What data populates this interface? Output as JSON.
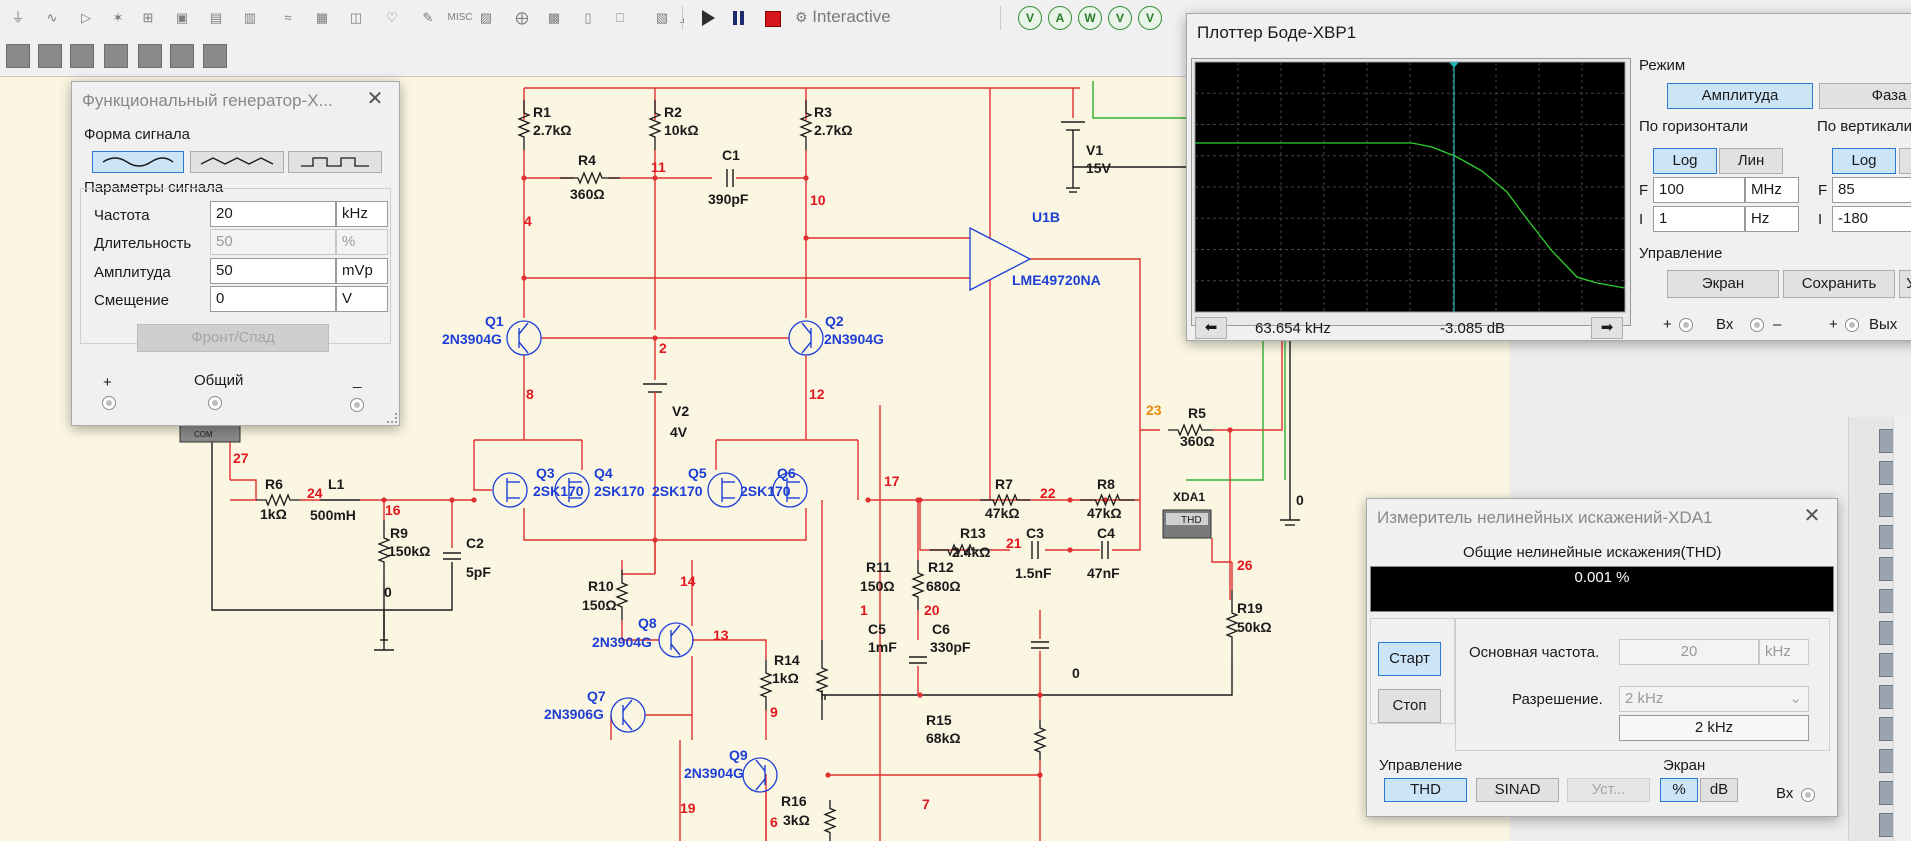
{
  "toolbar": {
    "icon_names": [
      "ground-icon",
      "ac-source-icon",
      "diode-icon",
      "transistor-icon",
      "opamp-icon",
      "ttl-icon",
      "cmos-icon",
      "mcu-icon",
      "adv-icon",
      "misc-digital-icon",
      "mixed-icon",
      "indicator-icon",
      "power-icon",
      "misc-icon",
      "peripherals-icon",
      "rf-icon",
      "electromech-icon",
      "ni-icon",
      "connector-icon",
      "hier-block-icon",
      "bus-icon"
    ],
    "misc_label": "MISC",
    "mode_label": "Interactive",
    "probe_icons": [
      "voltage-probe-icon",
      "current-probe-icon",
      "power-probe-icon",
      "diff-probe-icon",
      "ref-probe-icon"
    ],
    "probe_letters": [
      "V",
      "A",
      "W",
      "V",
      "V"
    ]
  },
  "func_gen": {
    "title": "Функциональный генератор-X...",
    "waveform_label": "Форма сигнала",
    "params_label": "Параметры сигнала",
    "freq_label": "Частота",
    "freq_value": "20",
    "freq_unit": "kHz",
    "duty_label": "Длительность",
    "duty_value": "50",
    "duty_unit": "%",
    "amp_label": "Амплитуда",
    "amp_value": "50",
    "amp_unit": "mVp",
    "offset_label": "Смещение",
    "offset_value": "0",
    "offset_unit": "V",
    "rise_button": "Фронт/Спад",
    "plus_label": "+",
    "common_label": "Общий",
    "minus_label": "_"
  },
  "bode": {
    "title": "Плоттер Боде-XBP1",
    "mode_label": "Режим",
    "amp_button": "Амплитуда",
    "phase_button": "Фаза",
    "horiz_label": "По горизонтали",
    "vert_label": "По вертикали",
    "log_label": "Log",
    "lin_label": "Лин",
    "log2_label": "Log",
    "hf_prefix": "F",
    "hf_value": "100",
    "hf_unit": "MHz",
    "hi_prefix": "I",
    "hi_value": "1",
    "hi_unit": "Hz",
    "vf_prefix": "F",
    "vf_value": "85",
    "vi_prefix": "I",
    "vi_value": "-180",
    "control_label": "Управление",
    "screen_button": "Экран",
    "save_button": "Сохранить",
    "set_button": "Уст.",
    "freq_readout": "63.654 kHz",
    "db_readout": "-3.085 dB",
    "in_label": "Вх",
    "out_label": "Вых",
    "plus": "+",
    "minus": "–",
    "curve_color": "#2fd02f",
    "cursor_color": "#23b0b0"
  },
  "thd": {
    "title": "Измеритель нелинейных искажений-XDA1",
    "thd_label": "Общие нелинейные искажения(THD)",
    "thd_value": "0.001 %",
    "start_button": "Старт",
    "stop_button": "Стоп",
    "fund_label": "Основная частота.",
    "fund_value": "20",
    "fund_unit": "kHz",
    "res_label": "Разрешение.",
    "res_select": "2 kHz",
    "res_value": "2 kHz",
    "control_label": "Управление",
    "thd_button": "THD",
    "sinad_button": "SINAD",
    "set_button": "Уст...",
    "screen_label": "Экран",
    "percent_button": "%",
    "db_button": "dB",
    "in_label": "Вх"
  },
  "schematic": {
    "wire_color": "#e03030",
    "wire_dark": "#1a1a1a",
    "wire_green": "#2fb02f",
    "label_color": "#1a1a1a",
    "part_color": "#1d3fd6",
    "net_color": "#e0171c",
    "net_orange": "#ea8a0a",
    "labels": [
      {
        "id": "r1",
        "t": "R1"
      },
      {
        "id": "r1v",
        "t": "2.7kΩ"
      },
      {
        "id": "r2",
        "t": "R2"
      },
      {
        "id": "r2v",
        "t": "10kΩ"
      },
      {
        "id": "r3",
        "t": "R3"
      },
      {
        "id": "r3v",
        "t": "2.7kΩ"
      },
      {
        "id": "r4",
        "t": "R4"
      },
      {
        "id": "r4v",
        "t": "360Ω"
      },
      {
        "id": "c1",
        "t": "C1"
      },
      {
        "id": "c1v",
        "t": "390pF"
      },
      {
        "id": "v1",
        "t": "V1"
      },
      {
        "id": "v1v",
        "t": "15V"
      },
      {
        "id": "u1b",
        "t": "U1B"
      },
      {
        "id": "lme",
        "t": "LME49720NA"
      },
      {
        "id": "q1",
        "t": "Q1"
      },
      {
        "id": "q1v",
        "t": "2N3904G"
      },
      {
        "id": "q2",
        "t": "Q2"
      },
      {
        "id": "q2v",
        "t": "2N3904G"
      },
      {
        "id": "v2",
        "t": "V2"
      },
      {
        "id": "v2v",
        "t": "4V"
      },
      {
        "id": "q3",
        "t": "Q3"
      },
      {
        "id": "q4",
        "t": "Q4"
      },
      {
        "id": "q5",
        "t": "Q5"
      },
      {
        "id": "q6",
        "t": "Q6"
      },
      {
        "id": "q3v",
        "t": "2SK170"
      },
      {
        "id": "q4v",
        "t": "2SK170"
      },
      {
        "id": "q5v",
        "t": "2SK170"
      },
      {
        "id": "q6v",
        "t": "2SK170"
      },
      {
        "id": "r5",
        "t": "R5"
      },
      {
        "id": "r5v",
        "t": "360Ω"
      },
      {
        "id": "r6",
        "t": "R6"
      },
      {
        "id": "r6v",
        "t": "1kΩ"
      },
      {
        "id": "l1",
        "t": "L1"
      },
      {
        "id": "l1v",
        "t": "500mH"
      },
      {
        "id": "r9",
        "t": "R9"
      },
      {
        "id": "r9v",
        "t": "150kΩ"
      },
      {
        "id": "c2",
        "t": "C2"
      },
      {
        "id": "c2v",
        "t": "5pF"
      },
      {
        "id": "r7",
        "t": "R7"
      },
      {
        "id": "r7v",
        "t": "47kΩ"
      },
      {
        "id": "r8",
        "t": "R8"
      },
      {
        "id": "r8v",
        "t": "47kΩ"
      },
      {
        "id": "r13",
        "t": "R13"
      },
      {
        "id": "r13v",
        "t": "2.4kΩ"
      },
      {
        "id": "c3",
        "t": "C3"
      },
      {
        "id": "c3v",
        "t": "1.5nF"
      },
      {
        "id": "c4",
        "t": "C4"
      },
      {
        "id": "c4v",
        "t": "47nF"
      },
      {
        "id": "xda",
        "t": "XDA1"
      },
      {
        "id": "thdbox",
        "t": "THD"
      },
      {
        "id": "r10",
        "t": "R10"
      },
      {
        "id": "r10v",
        "t": "150Ω"
      },
      {
        "id": "q8",
        "t": "Q8"
      },
      {
        "id": "q8v",
        "t": "2N3904G"
      },
      {
        "id": "r11",
        "t": "R11"
      },
      {
        "id": "r11v",
        "t": "150Ω"
      },
      {
        "id": "r12",
        "t": "R12"
      },
      {
        "id": "r12v",
        "t": "680Ω"
      },
      {
        "id": "c5",
        "t": "C5"
      },
      {
        "id": "c5v",
        "t": "1mF"
      },
      {
        "id": "c6",
        "t": "C6"
      },
      {
        "id": "c6v",
        "t": "330pF"
      },
      {
        "id": "r14",
        "t": "R14"
      },
      {
        "id": "r14v",
        "t": "1kΩ"
      },
      {
        "id": "q7",
        "t": "Q7"
      },
      {
        "id": "q7v",
        "t": "2N3906G"
      },
      {
        "id": "r15",
        "t": "R15"
      },
      {
        "id": "r15v",
        "t": "68kΩ"
      },
      {
        "id": "q9",
        "t": "Q9"
      },
      {
        "id": "q9v",
        "t": "2N3904G"
      },
      {
        "id": "r16",
        "t": "R16"
      },
      {
        "id": "r16v",
        "t": "3kΩ"
      },
      {
        "id": "r19",
        "t": "R19"
      },
      {
        "id": "r19v",
        "t": "50kΩ"
      },
      {
        "id": "com",
        "t": "COM"
      }
    ],
    "nets": [
      {
        "id": "n11",
        "t": "11"
      },
      {
        "id": "n10",
        "t": "10"
      },
      {
        "id": "n4",
        "t": "4"
      },
      {
        "id": "n2",
        "t": "2"
      },
      {
        "id": "n8",
        "t": "8"
      },
      {
        "id": "n12",
        "t": "12"
      },
      {
        "id": "n23",
        "t": "23"
      },
      {
        "id": "n27",
        "t": "27"
      },
      {
        "id": "n24",
        "t": "24"
      },
      {
        "id": "n16",
        "t": "16"
      },
      {
        "id": "n17",
        "t": "17"
      },
      {
        "id": "n22",
        "t": "22"
      },
      {
        "id": "n21",
        "t": "21"
      },
      {
        "id": "n14",
        "t": "14"
      },
      {
        "id": "n1",
        "t": "1"
      },
      {
        "id": "n20",
        "t": "20"
      },
      {
        "id": "n13",
        "t": "13"
      },
      {
        "id": "n9",
        "t": "9"
      },
      {
        "id": "n26",
        "t": "26"
      },
      {
        "id": "n0a",
        "t": "0"
      },
      {
        "id": "n0b",
        "t": "0"
      },
      {
        "id": "n0c",
        "t": "0"
      },
      {
        "id": "n19",
        "t": "19"
      },
      {
        "id": "n6",
        "t": "6"
      },
      {
        "id": "n7",
        "t": "7"
      }
    ]
  }
}
